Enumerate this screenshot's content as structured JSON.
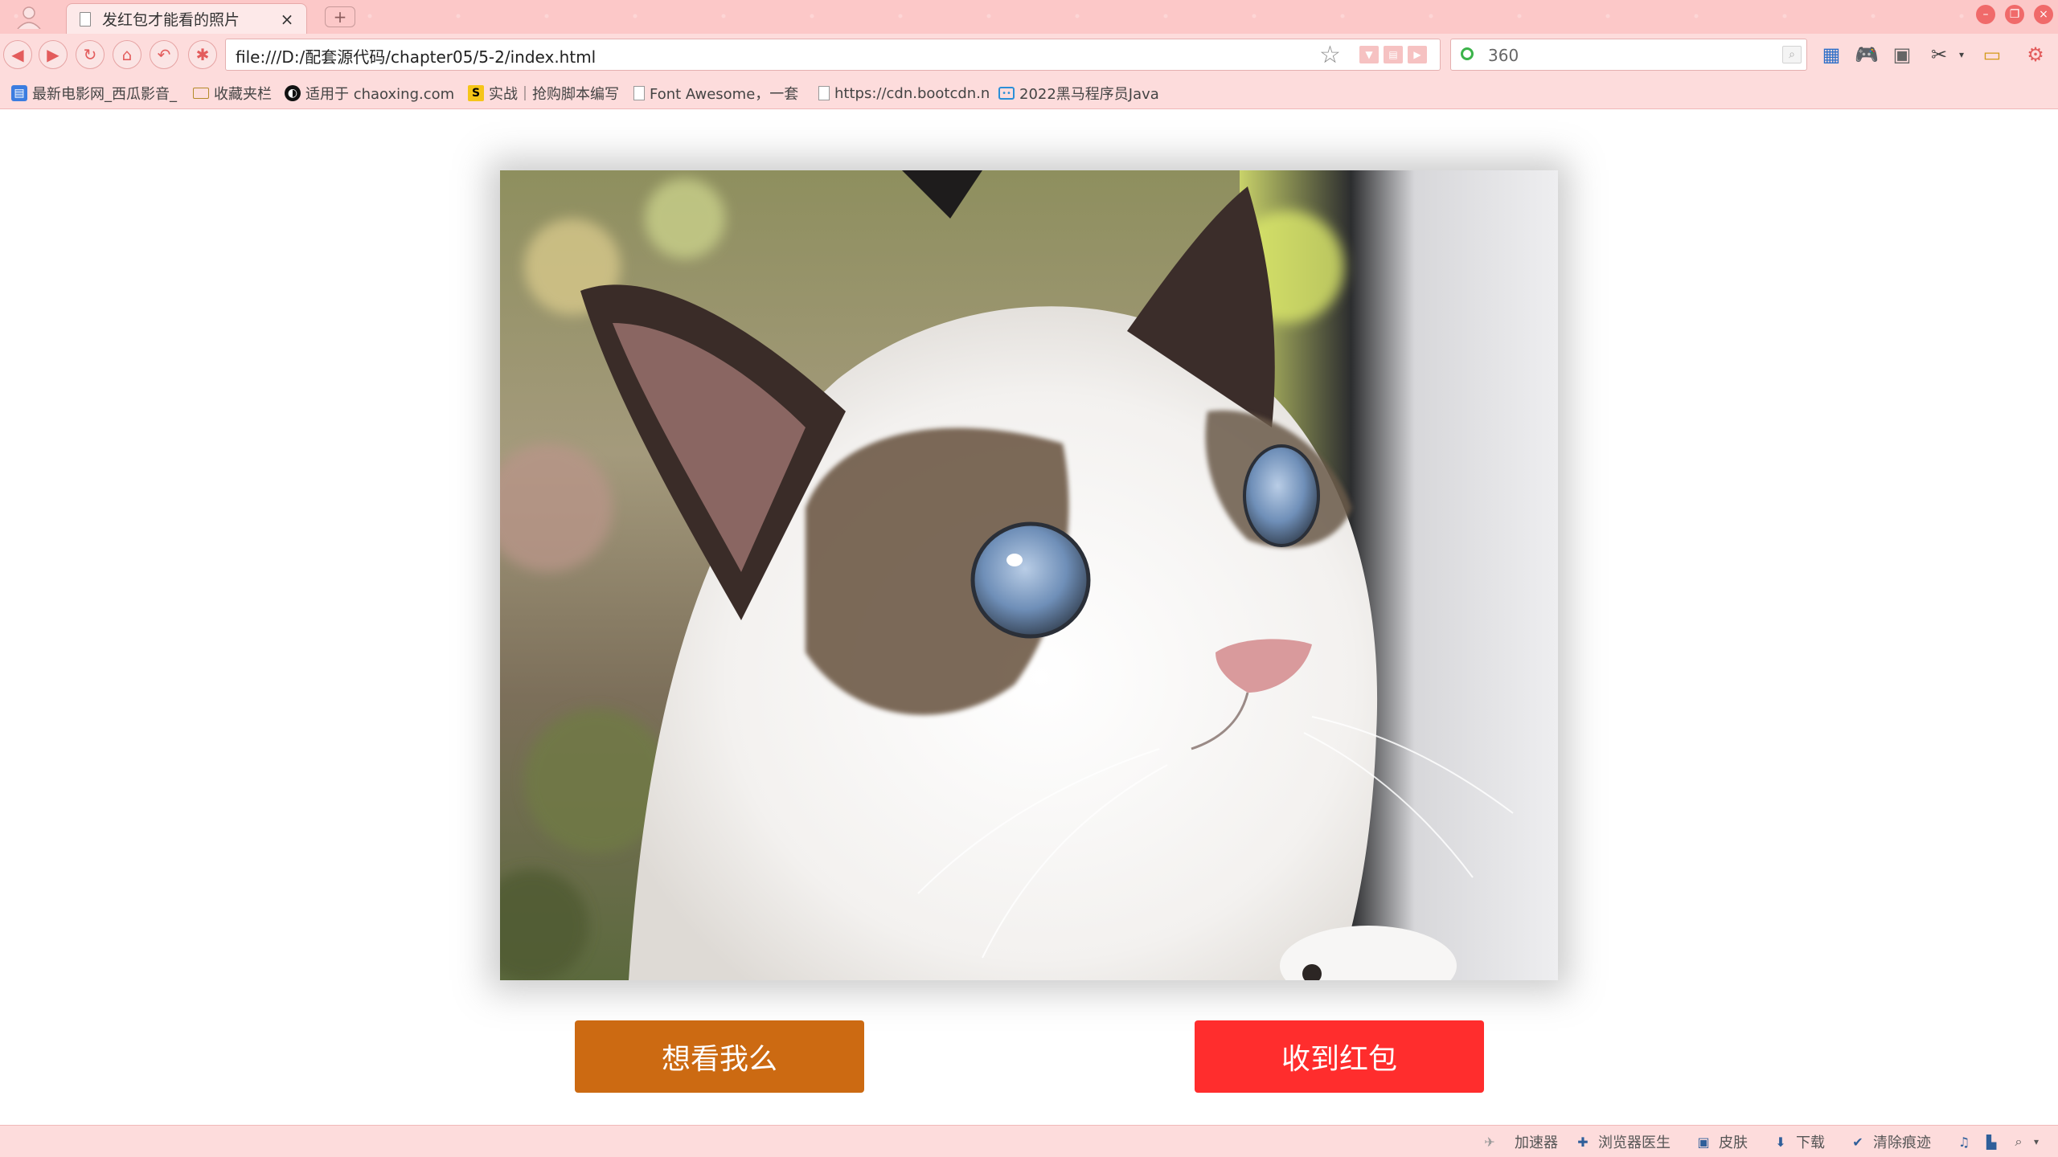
{
  "tab": {
    "title": "发红包才能看的照片",
    "close": "×",
    "new_tab": "+"
  },
  "window_controls": [
    "–",
    "❐",
    "×"
  ],
  "address": {
    "url": "file:///D:/配套源代码/chapter05/5-2/index.html"
  },
  "search": {
    "value": "360"
  },
  "bookmarks": [
    {
      "label": "最新电影网_西瓜影音_",
      "icon": "site-icon"
    },
    {
      "label": "收藏夹栏",
      "icon": "folder-icon"
    },
    {
      "label": "适用于 chaoxing.com",
      "icon": "site-icon"
    },
    {
      "label": "实战｜抢购脚本编写",
      "icon": "site-icon"
    },
    {
      "label": "Font Awesome，一套",
      "icon": "page-icon"
    },
    {
      "label": "https://cdn.bootcdn.n",
      "icon": "page-icon"
    },
    {
      "label": "2022黑马程序员Java",
      "icon": "tv-icon"
    }
  ],
  "buttons": {
    "see_me": "想看我么",
    "received_red_packet": "收到红包"
  },
  "status": {
    "accelerator": "加速器",
    "doctor": "浏览器医生",
    "skin": "皮肤",
    "download": "下载",
    "clear": "清除痕迹"
  },
  "colors": {
    "chrome": "#fcc8c8",
    "btn_see": "#cc6a12",
    "btn_red": "#ff2d2d"
  }
}
